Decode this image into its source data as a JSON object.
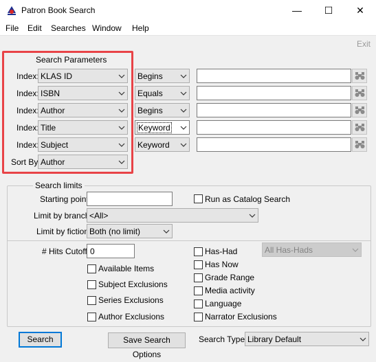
{
  "window": {
    "title": "Patron Book Search",
    "controls": {
      "minimize": "—",
      "maximize": "☐",
      "close": "✕"
    }
  },
  "menu": [
    "File",
    "Edit",
    "Searches",
    "Window",
    "Help"
  ],
  "toolbar": {
    "exit_label": "Exit"
  },
  "search_parameters": {
    "legend": "Search Parameters",
    "index_label": "Index:",
    "rows": [
      {
        "index": "KLAS ID",
        "operator": "Begins",
        "value": ""
      },
      {
        "index": "ISBN",
        "operator": "Equals",
        "value": ""
      },
      {
        "index": "Author",
        "operator": "Begins",
        "value": ""
      },
      {
        "index": "Title",
        "operator": "Keyword",
        "value": ""
      },
      {
        "index": "Subject",
        "operator": "Keyword",
        "value": ""
      }
    ],
    "sort_by_label": "Sort By:",
    "sort_by": "Author"
  },
  "search_limits": {
    "legend": "Search limits",
    "starting_point_label": "Starting point:",
    "starting_point": "",
    "run_as_catalog_label": "Run as Catalog Search",
    "branch_label": "Limit by branch:",
    "branch_value": "<All>",
    "fiction_label": "Limit by fiction:",
    "fiction_value": "Both (no limit)",
    "hits_cutoff_label": "# Hits Cutoff:",
    "hits_cutoff": "0",
    "left_checks": [
      "Available Items",
      "Subject Exclusions",
      "Series Exclusions",
      "Author Exclusions"
    ],
    "right_checks": [
      "Has-Had",
      "Has Now",
      "Grade Range",
      "Media activity",
      "Language",
      "Narrator Exclusions"
    ],
    "has_had_select": "All Has-Hads"
  },
  "footer": {
    "search_button": "Search",
    "save_button": "Save Search Options",
    "search_type_label": "Search Type:",
    "search_type": "Library Default"
  }
}
